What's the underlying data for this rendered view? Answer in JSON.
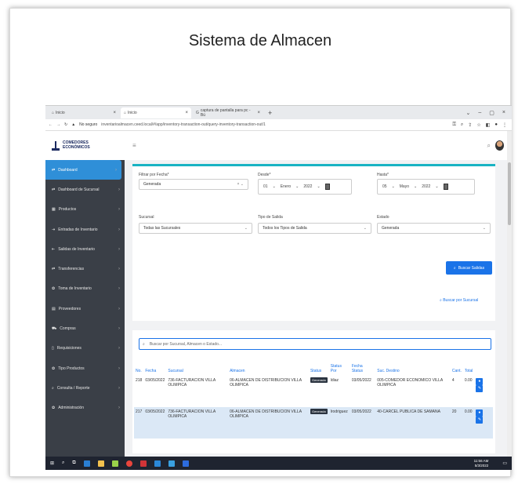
{
  "slide_title": "Sistema de Almacen",
  "browser": {
    "tabs": [
      {
        "label": "Inicio"
      },
      {
        "label": "Inicio"
      },
      {
        "label": "captura de pantalla para pc - Bú"
      }
    ],
    "not_secure": "No seguro",
    "url": "inventarioalmacen.ceed.local/#/app/inventory-transaction-out/query-inventory-transaction-out/1"
  },
  "sidebar": {
    "logo_line1": "COMEDORES",
    "logo_line2": "ECONÓMICOS",
    "items": [
      {
        "label": "Dashboard",
        "icon": "transfer-icon",
        "active": true
      },
      {
        "label": "Dashboard de Sucursal",
        "icon": "transfer-icon"
      },
      {
        "label": "Productos",
        "icon": "boxes-icon"
      },
      {
        "label": "Entradas de Inventario",
        "icon": "sign-in-icon"
      },
      {
        "label": "Salidas de Inventario",
        "icon": "sign-out-icon"
      },
      {
        "label": "Transferencias",
        "icon": "transfer-icon"
      },
      {
        "label": "Toma de Inventario",
        "icon": "gear-icon"
      },
      {
        "label": "Proveedores",
        "icon": "supplier-icon"
      },
      {
        "label": "Compras",
        "icon": "cart-icon"
      },
      {
        "label": "Requisiciones",
        "icon": "file-icon"
      },
      {
        "label": "Tipo Productos",
        "icon": "gear-icon"
      },
      {
        "label": "Consulta / Reporte",
        "icon": "search-icon"
      },
      {
        "label": "Administración",
        "icon": "gear-icon"
      }
    ]
  },
  "filters": {
    "filtrar_label": "Filtrar por Fecha*",
    "filtrar_value": "Generada",
    "desde_label": "Desde*",
    "desde": {
      "day": "01",
      "month": "Enero",
      "year": "2022"
    },
    "hasta_label": "Hasta*",
    "hasta": {
      "day": "05",
      "month": "Mayo",
      "year": "2022"
    },
    "sucursal_label": "Sucursal",
    "sucursal_value": "Todas las Sucursales",
    "tipo_label": "Tipo de Salida",
    "tipo_value": "Todos los Tipos de Salida",
    "estado_label": "Estado",
    "estado_value": "Generada",
    "buscar_button": "Buscar Salidas",
    "buscar_sucursal_link": "Buscar por Sucursal"
  },
  "results": {
    "search_placeholder": "Buscar por Sucursal, Almacen o Estado...",
    "columns": [
      "No.",
      "Fecha",
      "Sucursal",
      "Almacen",
      "Status",
      "Status Por",
      "Fecha Status",
      "Suc. Destino",
      "Cant.",
      "Total"
    ],
    "rows": [
      {
        "no": "218",
        "fecha": "03/05/2022",
        "sucursal": "736-FACTURACION VILLA OLIMPICA",
        "almacen": "06-ALMACEN DE DISTRIBUCION VILLA OLIMPICA",
        "status": "Generada",
        "status_por": "ldiaz",
        "fecha_status": "03/05/2022",
        "destino": "005-COMEDOR ECONOMICO VILLA OLIMPICA",
        "cant": "4",
        "total": "0.00"
      },
      {
        "no": "217",
        "fecha": "03/05/2022",
        "sucursal": "736-FACTURACION VILLA OLIMPICA",
        "almacen": "06-ALMACEN DE DISTRIBUCION VILLA OLIMPICA",
        "status": "Generada",
        "status_por": "lrodriguez",
        "fecha_status": "03/05/2022",
        "destino": "40-CARCEL PUBLICA DE SAMANA",
        "cant": "20",
        "total": "0.00"
      }
    ]
  },
  "taskbar": {
    "time": "11:56 AM",
    "date": "5/3/2022"
  }
}
